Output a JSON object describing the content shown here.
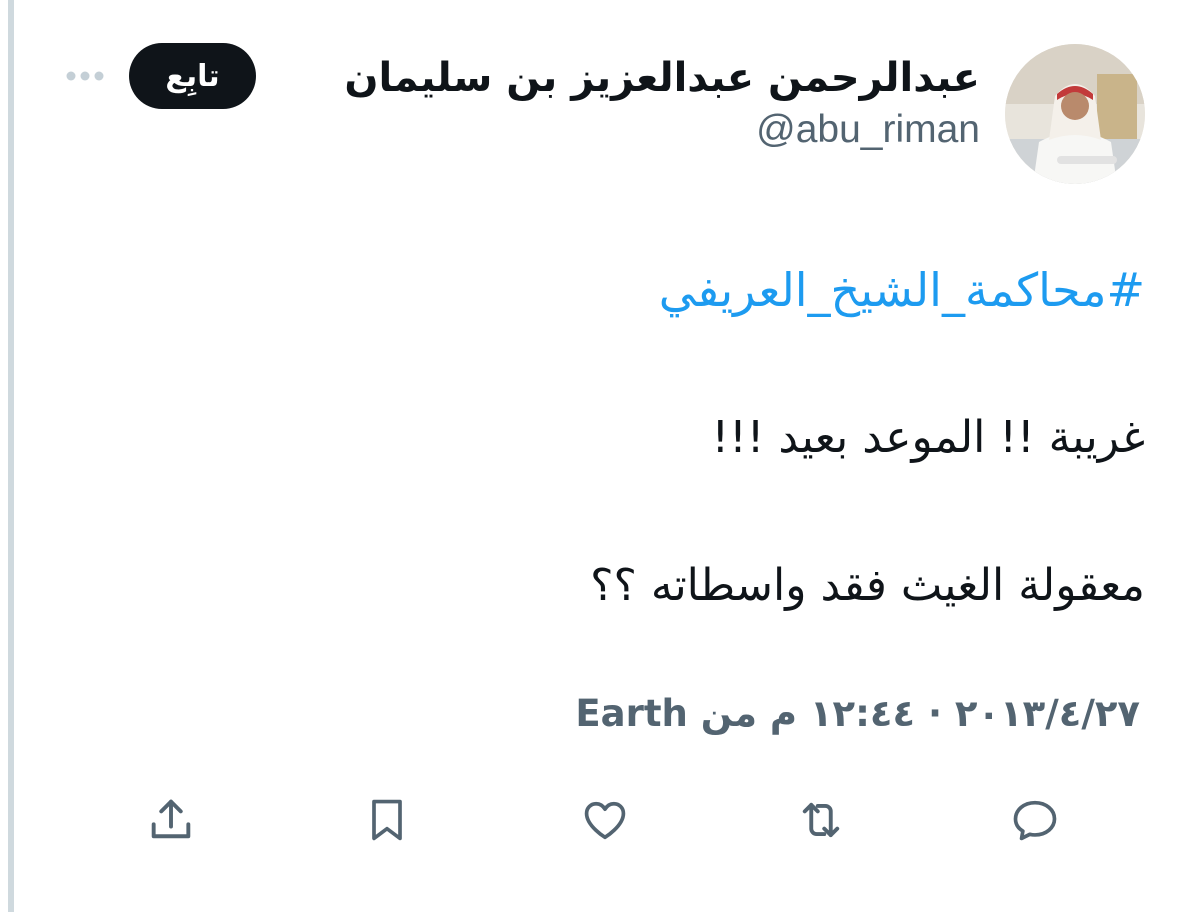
{
  "author": {
    "display_name": "عبدالرحمن عبدالعزيز بن سليمان",
    "handle": "@abu_riman",
    "avatar_icon": "user-avatar-photo"
  },
  "header": {
    "follow_label": "تابِع",
    "more_icon": "more-dots-icon"
  },
  "tweet": {
    "hashtag": "#محاكمة_الشيخ_العريفي",
    "lines": [
      "غريبة !! الموعد بعيد !!!",
      "معقولة الغيث فقد واسطاته ؟؟"
    ]
  },
  "meta": {
    "timestamp": "١٢:٤٤ م",
    "date": "٢٠١٣/٤/٢٧",
    "separator": "·",
    "source_prefix": "من",
    "source": "Earth"
  },
  "actions": [
    {
      "name": "reply",
      "icon": "reply-icon"
    },
    {
      "name": "retweet",
      "icon": "retweet-icon"
    },
    {
      "name": "like",
      "icon": "heart-icon"
    },
    {
      "name": "bookmark",
      "icon": "bookmark-icon"
    },
    {
      "name": "share",
      "icon": "share-icon"
    }
  ],
  "colors": {
    "accent": "#1d9bf0",
    "text": "#0f1419",
    "muted": "#536471",
    "button_bg": "#0f1419"
  }
}
